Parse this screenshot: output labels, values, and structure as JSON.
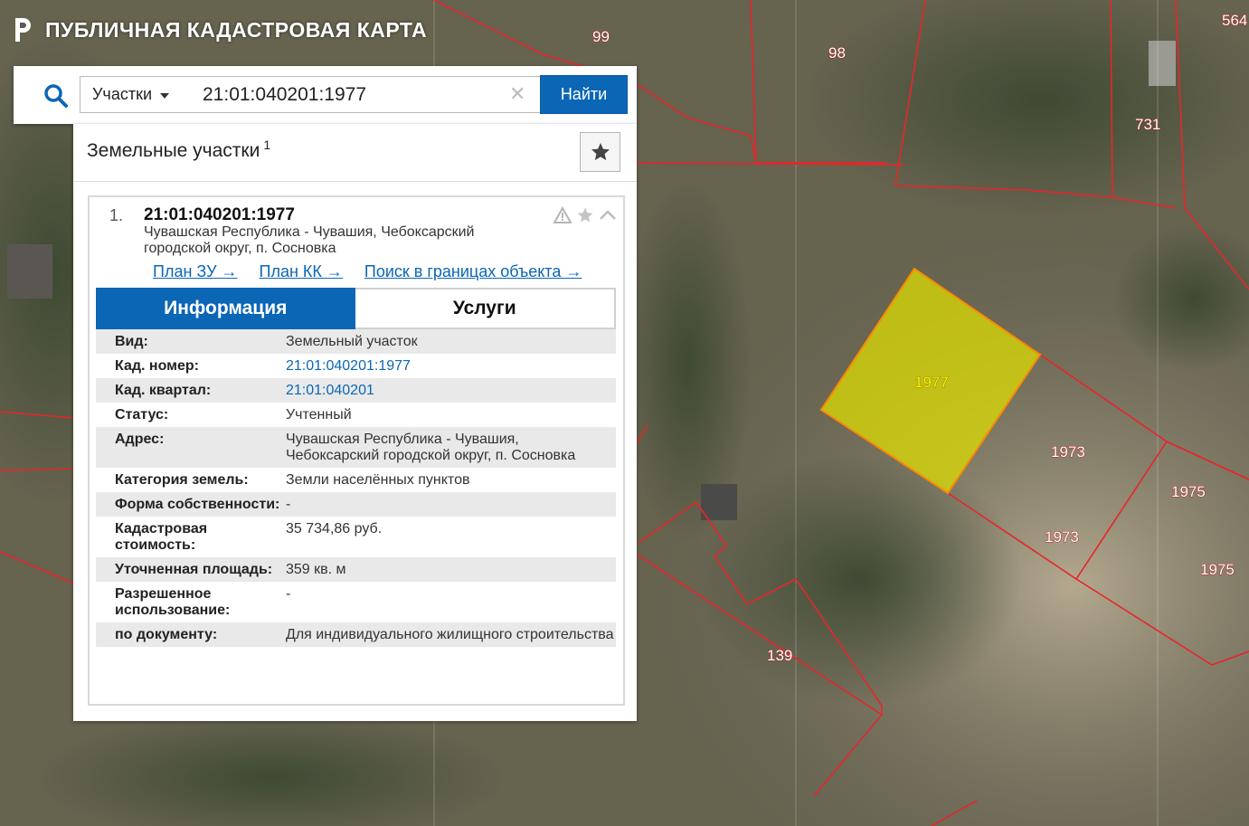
{
  "app": {
    "title": "ПУБЛИЧНАЯ КАДАСТРОВАЯ КАРТА"
  },
  "search": {
    "category": "Участки",
    "query": "21:01:040201:1977",
    "button": "Найти"
  },
  "results": {
    "title": "Земельные участки",
    "count": "1",
    "item": {
      "index": "1.",
      "cadastral_number": "21:01:040201:1977",
      "address_line1": "Чувашская Республика - Чувашия, Чебоксарский",
      "address_line2": "городской округ, п. Сосновка",
      "links": [
        "План ЗУ →",
        "План КК →",
        "Поиск в границах объекта →"
      ],
      "tabs": {
        "info": "Информация",
        "services": "Услуги"
      },
      "properties": [
        {
          "label": "Вид:",
          "value": "Земельный участок"
        },
        {
          "label": "Кад. номер:",
          "value": "21:01:040201:1977"
        },
        {
          "label": "Кад. квартал:",
          "value": "21:01:040201"
        },
        {
          "label": "Статус:",
          "value": "Учтенный"
        },
        {
          "label": "Адрес:",
          "value": "Чувашская Республика - Чувашия, Чебоксарский городской округ, п. Сосновка"
        },
        {
          "label": "Категория земель:",
          "value": "Земли населённых пунктов"
        },
        {
          "label": "Форма собственности:",
          "value": "-"
        },
        {
          "label": "Кадастровая стоимость:",
          "value": "35 734,86 руб."
        },
        {
          "label": "Уточненная площадь:",
          "value": "359 кв. м"
        },
        {
          "label": "Разрешенное использование:",
          "value": "-"
        },
        {
          "label": "по документу:",
          "value": "Для индивидуального жилищного строительства"
        }
      ]
    }
  },
  "map": {
    "parcel_labels": [
      "99",
      "98",
      "564",
      "731",
      "1977",
      "1973",
      "1973",
      "1975",
      "1975",
      "139"
    ],
    "colors": {
      "boundary": "#e8252a",
      "selected_fill": "#e1e000",
      "selected_stroke": "#ff8800",
      "accent": "#0b66b5"
    }
  }
}
